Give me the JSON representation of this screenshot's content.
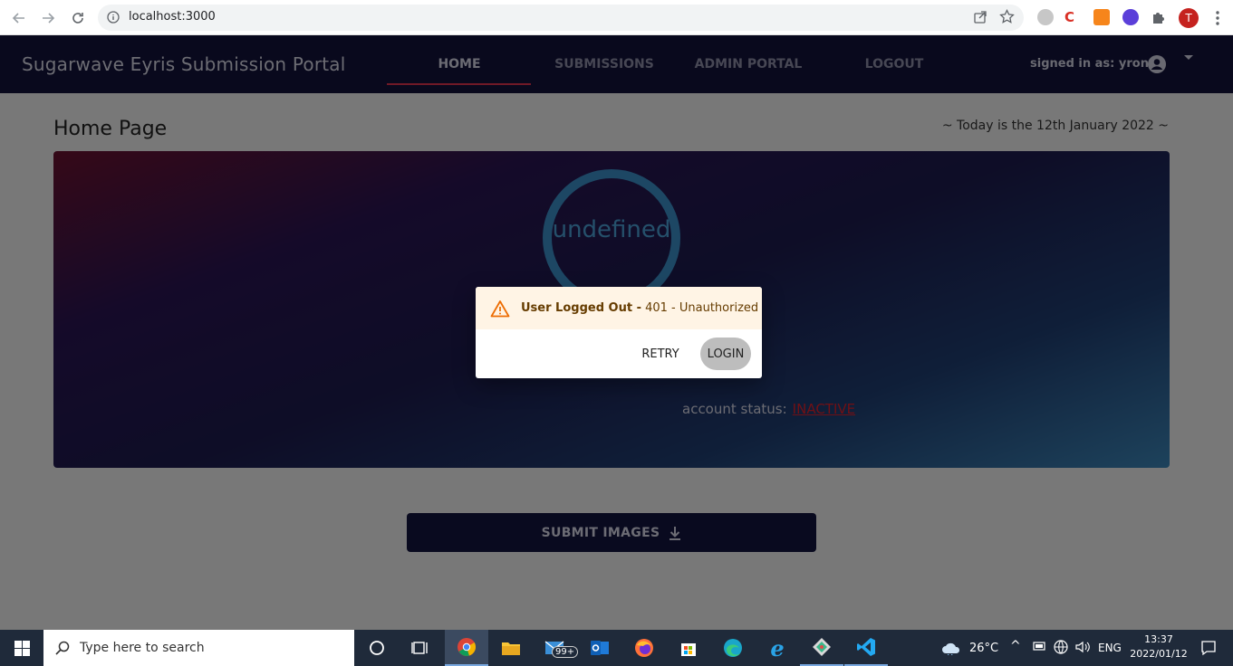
{
  "browser": {
    "url": "localhost:3000",
    "profile_initial": "T"
  },
  "navbar": {
    "brand": "Sugarwave Eyris Submission Portal",
    "items": [
      {
        "label": "HOME",
        "active": true
      },
      {
        "label": "SUBMISSIONS",
        "active": false
      },
      {
        "label": "ADMIN PORTAL",
        "active": false
      },
      {
        "label": "LOGOUT",
        "active": false
      }
    ],
    "signed_in_text": "signed in as: yron"
  },
  "page": {
    "title": "Home Page",
    "date_text": "~ Today is the 12th January 2022 ~",
    "ring_label": "undefined",
    "account_status_label": "account status:",
    "account_status_value": "INACTIVE",
    "submit_button": "SUBMIT IMAGES"
  },
  "dialog": {
    "alert_title": "User Logged Out -",
    "alert_message": "401 - Unauthorized",
    "retry_label": "RETRY",
    "login_label": "LOGIN"
  },
  "taskbar": {
    "search_placeholder": "Type here to search",
    "mail_badge": "99+",
    "weather": "26°C",
    "language": "ENG",
    "time": "13:37",
    "date": "2022/01/12"
  },
  "colors": {
    "navbar_bg": "#12133a",
    "accent_underline": "#e0334f",
    "status_inactive": "#e0202a",
    "alert_bg": "#fff4e5",
    "warning": "#ed6c02"
  }
}
